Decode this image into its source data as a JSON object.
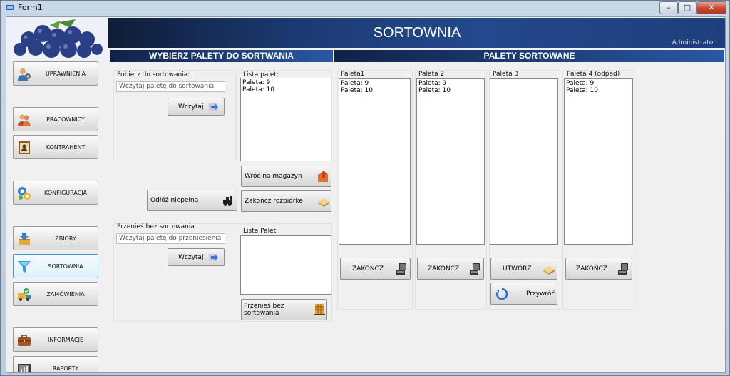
{
  "window": {
    "title": "Form1",
    "minimize": "–",
    "maximize": "□",
    "close": "✕"
  },
  "header": {
    "title": "SORTOWNIA",
    "user": "Administrator"
  },
  "sections": {
    "left": "WYBIERZ PALETY DO SORTWANIA",
    "right": "PALETY SORTOWANE"
  },
  "sidebar": [
    {
      "label": "UPRAWNIENIA",
      "icon": "users-admin-icon"
    },
    {
      "label": "PRACOWNICY",
      "icon": "workers-icon"
    },
    {
      "label": "KONTRAHENT",
      "icon": "contact-book-icon"
    },
    {
      "label": "KONFIGURACJA",
      "icon": "gears-icon"
    },
    {
      "label": "ZBIORY",
      "icon": "harvest-box-icon"
    },
    {
      "label": "SORTOWNIA",
      "icon": "funnel-icon"
    },
    {
      "label": "ZAMÓWIENIA",
      "icon": "truck-icon"
    },
    {
      "label": "INFORMACJE",
      "icon": "briefcase-icon"
    },
    {
      "label": "RAPORTY",
      "icon": "report-icon"
    }
  ],
  "pobierz": {
    "label": "Pobierz do sortowania:",
    "placeholder": "Wczytaj paletę do sortowania",
    "button": "Wczytaj"
  },
  "lista_palet": {
    "label": "Lista palet:",
    "items": [
      "Paleta: 9",
      "Paleta: 10"
    ]
  },
  "buttons": {
    "wroc": "Wróć na magazyn",
    "zakoncz_rozbiorke": "Zakończ rozbiórke",
    "odloz": "Odłóż niepełną",
    "przenies_bez": "Przenieś bez sortowania"
  },
  "przenies": {
    "label": "Przenieś bez sortowania",
    "placeholder": "Wczytaj paletę do przeniesienia",
    "button": "Wczytaj",
    "list_label": "Lista Palet"
  },
  "palety": [
    {
      "label": "Paleta1",
      "items": [
        "Paleta: 9",
        "Paleta: 10"
      ],
      "button": "ZAKOŃCZ"
    },
    {
      "label": "Paleta 2",
      "items": [
        "Paleta: 9",
        "Paleta: 10"
      ],
      "button": "ZAKOŃCZ"
    },
    {
      "label": "Paleta 3",
      "items": [],
      "button": "UTWÓRZ",
      "extra_button": "Przywróć"
    },
    {
      "label": "Paleta 4 (odpad)",
      "items": [
        "Paleta: 9",
        "Paleta: 10"
      ],
      "button": "ZAKOŃCZ"
    }
  ]
}
